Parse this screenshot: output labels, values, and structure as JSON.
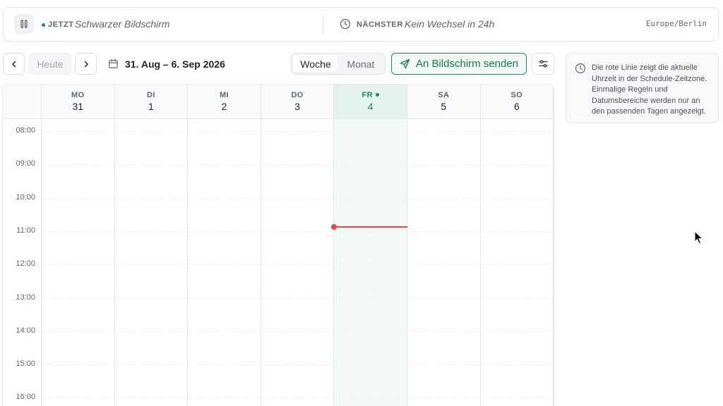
{
  "status_bar": {
    "now_label": "JETZT",
    "now_value": "Schwarzer Bildschirm",
    "next_label": "NÄCHSTER",
    "next_value": "Kein Wechsel in 24h",
    "timezone": "Europe/Berlin",
    "pause_icon": "pause-icon",
    "clock_icon": "clock-icon"
  },
  "toolbar": {
    "prev_icon": "chevron-left-icon",
    "today_label": "Heute",
    "next_icon": "chevron-right-icon",
    "range_icon": "calendar-icon",
    "range_label": "31. Aug – 6. Sep 2026",
    "view_tabs": [
      {
        "label": "Woche",
        "active": true
      },
      {
        "label": "Monat",
        "active": false
      }
    ],
    "send_label": "An Bildschirm senden",
    "send_icon": "send-icon",
    "filter_icon": "sliders-icon"
  },
  "calendar": {
    "days": [
      {
        "abbr": "MO",
        "num": "31",
        "today": false
      },
      {
        "abbr": "DI",
        "num": "1",
        "today": false
      },
      {
        "abbr": "MI",
        "num": "2",
        "today": false
      },
      {
        "abbr": "DO",
        "num": "3",
        "today": false
      },
      {
        "abbr": "FR",
        "num": "4",
        "today": true
      },
      {
        "abbr": "SA",
        "num": "5",
        "today": false
      },
      {
        "abbr": "SO",
        "num": "6",
        "today": false
      }
    ],
    "hours": [
      "08:00",
      "09:00",
      "10:00",
      "11:00",
      "12:00",
      "13:00",
      "14:00",
      "15:00",
      "16:00"
    ],
    "current_time": "10:53",
    "colors": {
      "today": "#1f8a5b",
      "now_line": "#d9484f"
    }
  },
  "info": {
    "icon": "clock-icon",
    "text": "Die rote Linie zeigt die aktuelle Uhrzeit in der Schedule-Zeitzone. Einmalige Regeln und Datumsbereiche werden nur an den passenden Tagen angezeigt."
  }
}
